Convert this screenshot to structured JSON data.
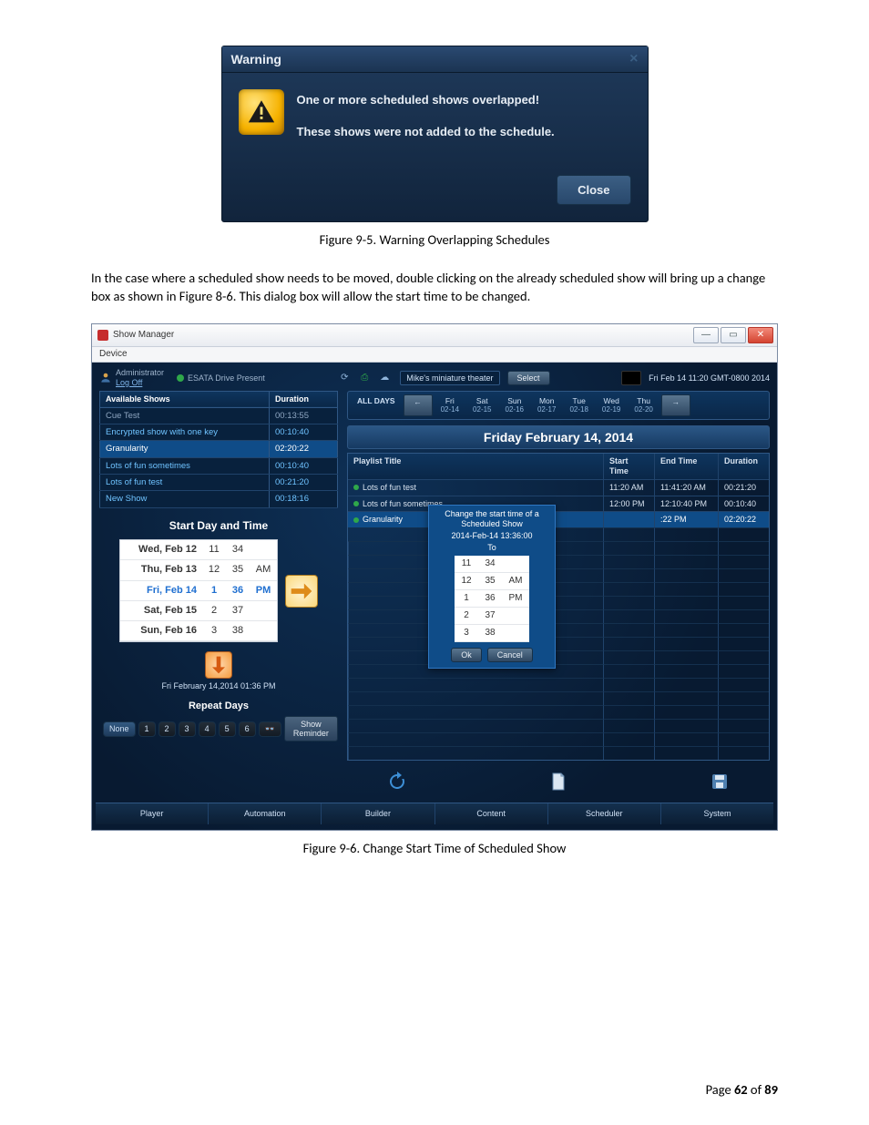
{
  "warning_dialog": {
    "title": "Warning",
    "msg1": "One or more scheduled shows overlapped!",
    "msg2": "These shows were not added to the schedule.",
    "close_label": "Close"
  },
  "caption1": "Figure 9-5.  Warning Overlapping Schedules",
  "body_para": "In the case where a scheduled show needs to be moved, double clicking on the already scheduled show will bring up a change box as shown in Figure 8-6.  This dialog box will allow the start time to be changed.",
  "caption2": "Figure 9-6.  Change Start Time of Scheduled Show",
  "show_manager": {
    "window_title": "Show Manager",
    "menubar": "Device",
    "topbar": {
      "admin": "Administrator",
      "logoff": "Log Off",
      "drive_label": "ESATA Drive Present",
      "theater": "Mike's miniature theater",
      "select_label": "Select",
      "datetime": "Fri Feb 14 11:20 GMT-0800 2014"
    },
    "shows": {
      "col_title": "Available Shows",
      "col_duration": "Duration",
      "rows": [
        {
          "name": "Cue Test",
          "dur": "00:13:55",
          "cls": "cue"
        },
        {
          "name": "Encrypted show with one key",
          "dur": "00:10:40",
          "cls": "blue"
        },
        {
          "name": "Granularity",
          "dur": "02:20:22",
          "cls": "sel"
        },
        {
          "name": "Lots of fun sometimes",
          "dur": "00:10:40",
          "cls": "blue"
        },
        {
          "name": "Lots of fun test",
          "dur": "00:21:20",
          "cls": "blue"
        },
        {
          "name": "New Show",
          "dur": "00:18:16",
          "cls": "blue"
        }
      ]
    },
    "sdt": {
      "heading": "Start Day and Time",
      "scroller": {
        "days": [
          "Wed, Feb 12",
          "Thu, Feb 13",
          "Fri, Feb 14",
          "Sat, Feb 15",
          "Sun, Feb 16"
        ],
        "hours": [
          "11",
          "12",
          "1",
          "2",
          "3"
        ],
        "mins": [
          "34",
          "35",
          "36",
          "37",
          "38"
        ],
        "ampm": [
          "",
          "AM",
          "PM",
          "",
          ""
        ],
        "selected_index": 2
      },
      "summary": "Fri February 14,2014  01:36 PM",
      "repeat_heading": "Repeat Days",
      "pills": [
        "None",
        "1",
        "2",
        "3",
        "4",
        "5",
        "6"
      ],
      "reminder_label": "Show Reminder"
    },
    "right": {
      "day_tabs": {
        "all_label": "ALL DAYS",
        "days": [
          {
            "d": "Fri",
            "s": "02-14"
          },
          {
            "d": "Sat",
            "s": "02-15"
          },
          {
            "d": "Sun",
            "s": "02-16"
          },
          {
            "d": "Mon",
            "s": "02-17"
          },
          {
            "d": "Tue",
            "s": "02-18"
          },
          {
            "d": "Wed",
            "s": "02-19"
          },
          {
            "d": "Thu",
            "s": "02-20"
          }
        ]
      },
      "banner": "Friday  February 14, 2014",
      "sched_cols": {
        "c1": "Playlist Title",
        "c2": "Start Time",
        "c3": "End Time",
        "c4": "Duration"
      },
      "sched_rows": [
        {
          "title": "Lots of fun test",
          "start": "11:20 AM",
          "end": "11:41:20 AM",
          "dur": "00:21:20",
          "active": false
        },
        {
          "title": "Lots of fun sometimes",
          "start": "12:00 PM",
          "end": "12:10:40 PM",
          "dur": "00:10:40",
          "active": false
        },
        {
          "title": "Granularity",
          "start": "",
          "end": ":22 PM",
          "dur": "02:20:22",
          "active": true
        }
      ],
      "popup": {
        "title": "Change the start time of a Scheduled Show",
        "dt": "2014-Feb-14 13:36:00",
        "to": "To",
        "hours": [
          "11",
          "12",
          "1",
          "2",
          "3"
        ],
        "mins": [
          "34",
          "35",
          "36",
          "37",
          "38"
        ],
        "ampm": [
          "",
          "AM",
          "PM",
          "",
          ""
        ],
        "ok": "Ok",
        "cancel": "Cancel"
      },
      "navtabs": [
        "Player",
        "Automation",
        "Builder",
        "Content",
        "Scheduler",
        "System"
      ]
    }
  },
  "footer": {
    "pre": "Page ",
    "cur": "62",
    "mid": " of ",
    "tot": "89"
  }
}
